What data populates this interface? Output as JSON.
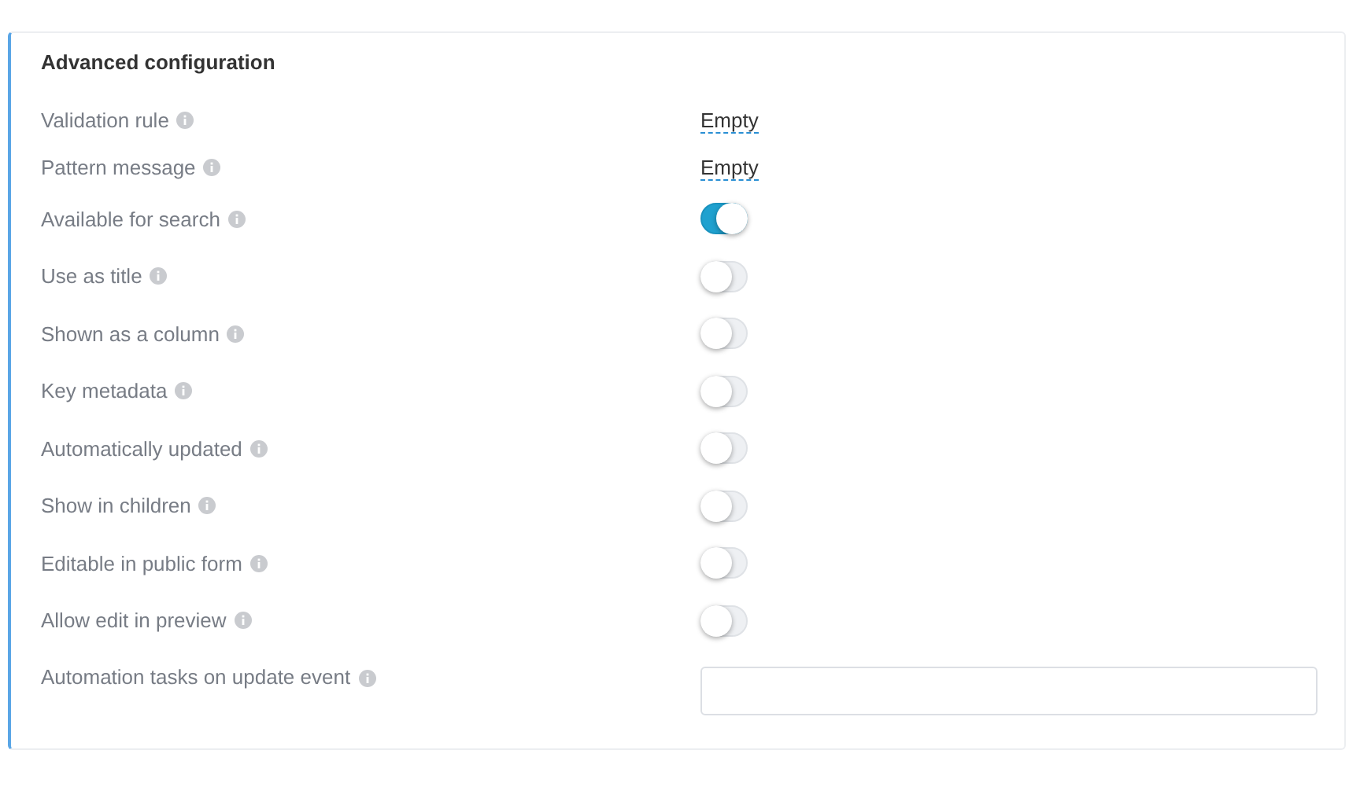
{
  "panel": {
    "title": "Advanced configuration",
    "rows": [
      {
        "kind": "text",
        "label": "Validation rule",
        "value": "Empty"
      },
      {
        "kind": "text",
        "label": "Pattern message",
        "value": "Empty"
      },
      {
        "kind": "toggle",
        "label": "Available for search",
        "on": true
      },
      {
        "kind": "toggle",
        "label": "Use as title",
        "on": false
      },
      {
        "kind": "toggle",
        "label": "Shown as a column",
        "on": false
      },
      {
        "kind": "toggle",
        "label": "Key metadata",
        "on": false
      },
      {
        "kind": "toggle",
        "label": "Automatically updated",
        "on": false
      },
      {
        "kind": "toggle",
        "label": "Show in children",
        "on": false
      },
      {
        "kind": "toggle",
        "label": "Editable in public form",
        "on": false
      },
      {
        "kind": "toggle",
        "label": "Allow edit in preview",
        "on": false
      },
      {
        "kind": "field",
        "label": "Automation tasks on update event"
      }
    ]
  }
}
